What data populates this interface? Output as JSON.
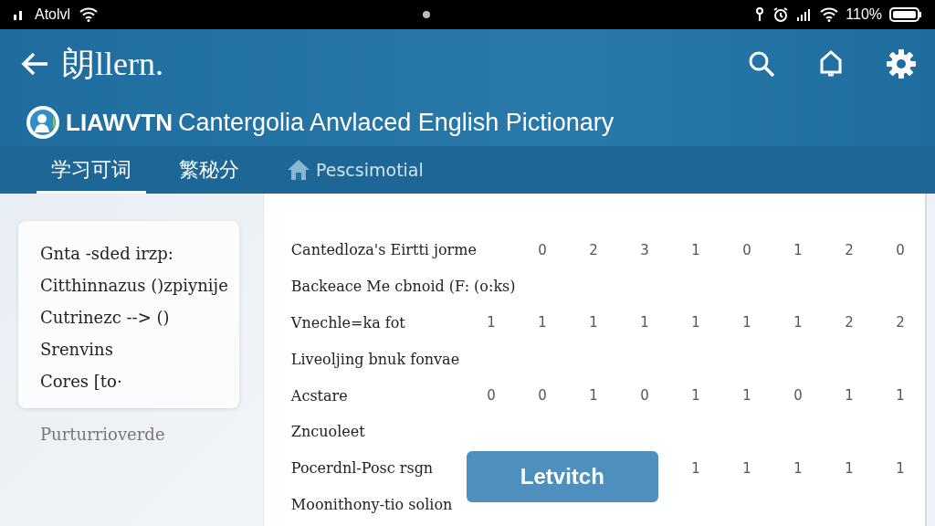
{
  "status_bar": {
    "carrier": "Atolvl",
    "battery": "110%"
  },
  "app_bar": {
    "title": "朗llern."
  },
  "banner": {
    "brand": "LIAWVTN",
    "title": "Cantergolia Anvlaced English Pictionary"
  },
  "tabs": [
    {
      "label": "学习可词",
      "selected": true,
      "kind": "text"
    },
    {
      "label": "繁秘分",
      "selected": false,
      "kind": "text"
    },
    {
      "label": "Pescsimotial",
      "selected": false,
      "kind": "home"
    }
  ],
  "sidebar": {
    "items": [
      "Gnta -sded irzp:",
      "Citthinnazus ()zpiynije",
      "Cutrinezc  --> ()",
      "Srenvins",
      "Cores [to·"
    ],
    "footer": "Purturrioverde"
  },
  "table": {
    "rows": [
      {
        "label": "Cantedloza's Eirtti jorme",
        "values": [
          "0",
          "2",
          "3",
          "1",
          "0",
          "1",
          "2",
          "0"
        ]
      },
      {
        "label": "Backeace Me cbnoid (F: (o:ks)",
        "values": []
      },
      {
        "label": "Vnechle=ka fot",
        "values": [
          "1",
          "1",
          "1",
          "1",
          "1",
          "1",
          "1",
          "2",
          "2"
        ]
      },
      {
        "label": "Liveoljing bnuk fonvae",
        "values": []
      },
      {
        "label": "Acstare",
        "values": [
          "0",
          "0",
          "1",
          "0",
          "1",
          "1",
          "0",
          "1",
          "1"
        ]
      },
      {
        "label": "Zncuoleet",
        "values": []
      },
      {
        "label": "Pocerdnl-Posc rsgn",
        "values": [
          "1",
          "1",
          "1",
          "1",
          "1"
        ]
      },
      {
        "label": "Moonithony-tio solion",
        "values": []
      }
    ]
  },
  "floating_button": {
    "label": "Letvitch"
  }
}
